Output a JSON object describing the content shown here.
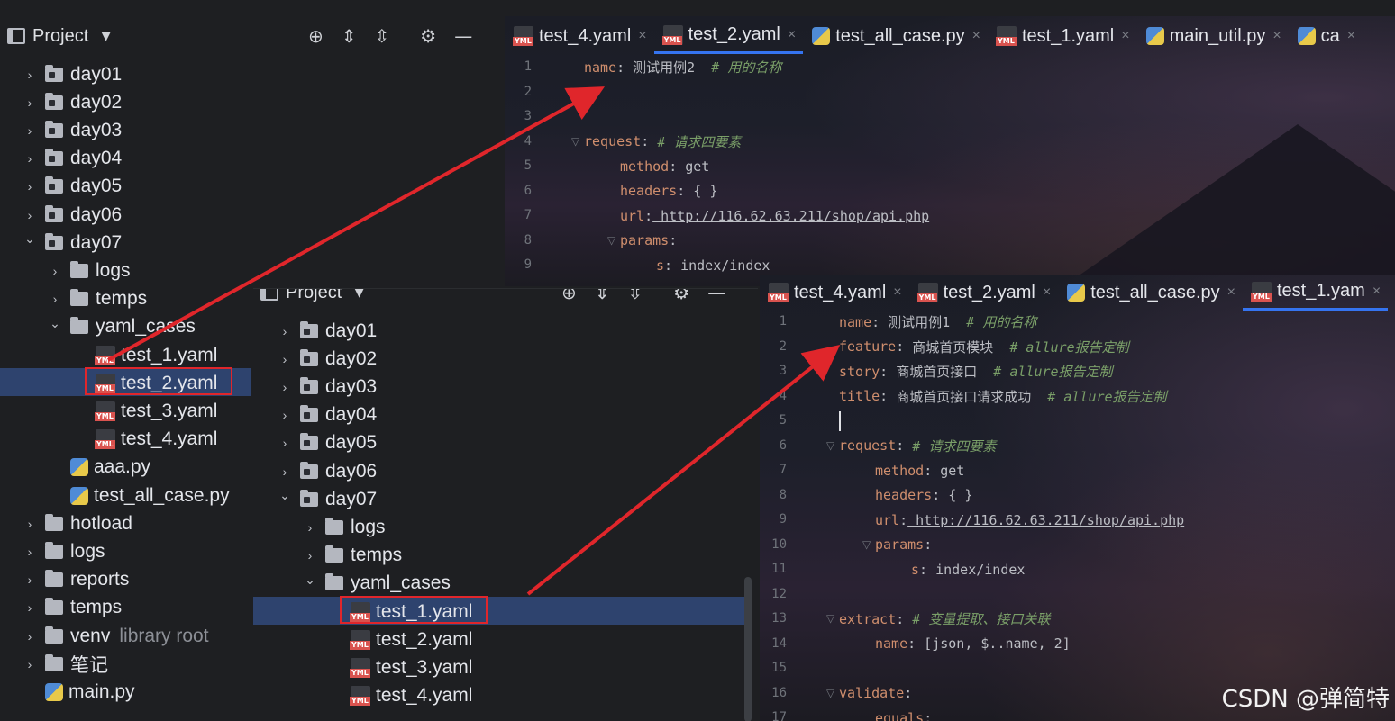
{
  "back_window": {
    "project_title": "Project",
    "tree": [
      {
        "label": "day01",
        "kind": "folder",
        "depth": 0,
        "open": false
      },
      {
        "label": "day02",
        "kind": "folder",
        "depth": 0,
        "open": false
      },
      {
        "label": "day03",
        "kind": "folder",
        "depth": 0,
        "open": false
      },
      {
        "label": "day04",
        "kind": "folder",
        "depth": 0,
        "open": false
      },
      {
        "label": "day05",
        "kind": "folder",
        "depth": 0,
        "open": false
      },
      {
        "label": "day06",
        "kind": "folder",
        "depth": 0,
        "open": false
      },
      {
        "label": "day07",
        "kind": "folder",
        "depth": 0,
        "open": true
      },
      {
        "label": "logs",
        "kind": "folder",
        "depth": 1,
        "open": false
      },
      {
        "label": "temps",
        "kind": "folder",
        "depth": 1,
        "open": false
      },
      {
        "label": "yaml_cases",
        "kind": "folder",
        "depth": 1,
        "open": true
      },
      {
        "label": "test_1.yaml",
        "kind": "yaml",
        "depth": 2
      },
      {
        "label": "test_2.yaml",
        "kind": "yaml",
        "depth": 2,
        "selected": true
      },
      {
        "label": "test_3.yaml",
        "kind": "yaml",
        "depth": 2
      },
      {
        "label": "test_4.yaml",
        "kind": "yaml",
        "depth": 2
      },
      {
        "label": "aaa.py",
        "kind": "py",
        "depth": 1
      },
      {
        "label": "test_all_case.py",
        "kind": "py",
        "depth": 1
      },
      {
        "label": "hotload",
        "kind": "folder",
        "depth": 0,
        "open": false
      },
      {
        "label": "logs",
        "kind": "folder",
        "depth": 0,
        "open": false
      },
      {
        "label": "reports",
        "kind": "folder",
        "depth": 0,
        "open": false
      },
      {
        "label": "temps",
        "kind": "folder",
        "depth": 0,
        "open": false
      },
      {
        "label": "venv",
        "kind": "folder",
        "depth": 0,
        "open": false,
        "suffix": "library root"
      },
      {
        "label": "笔记",
        "kind": "folder",
        "depth": 0,
        "open": false
      },
      {
        "label": "main.py",
        "kind": "py",
        "depth": 0
      }
    ],
    "tabs": [
      {
        "label": "test_4.yaml",
        "kind": "yaml"
      },
      {
        "label": "test_2.yaml",
        "kind": "yaml",
        "active": true
      },
      {
        "label": "test_all_case.py",
        "kind": "py"
      },
      {
        "label": "test_1.yaml",
        "kind": "yaml"
      },
      {
        "label": "main_util.py",
        "kind": "py"
      },
      {
        "label": "ca",
        "kind": "py"
      }
    ],
    "code": [
      {
        "n": "1",
        "indent": 0,
        "key": "name",
        "val": " 测试用例2",
        "comment": "  # 用的名称"
      },
      {
        "n": "2",
        "indent": 0
      },
      {
        "n": "3",
        "indent": 0
      },
      {
        "n": "4",
        "indent": 0,
        "key": "request",
        "val": "",
        "comment": " # 请求四要素"
      },
      {
        "n": "5",
        "indent": 1,
        "key": "method",
        "val": " get"
      },
      {
        "n": "6",
        "indent": 1,
        "key": "headers",
        "val": " { }"
      },
      {
        "n": "7",
        "indent": 1,
        "key": "url",
        "url": " http://116.62.63.211/shop/api.php"
      },
      {
        "n": "8",
        "indent": 1,
        "key": "params",
        "val": ""
      },
      {
        "n": "9",
        "indent": 2,
        "key": "s",
        "val": " index/index"
      }
    ]
  },
  "front_window": {
    "project_title": "Project",
    "tree": [
      {
        "label": "day01",
        "kind": "folder",
        "depth": 0,
        "open": false
      },
      {
        "label": "day02",
        "kind": "folder",
        "depth": 0,
        "open": false
      },
      {
        "label": "day03",
        "kind": "folder",
        "depth": 0,
        "open": false
      },
      {
        "label": "day04",
        "kind": "folder",
        "depth": 0,
        "open": false
      },
      {
        "label": "day05",
        "kind": "folder",
        "depth": 0,
        "open": false
      },
      {
        "label": "day06",
        "kind": "folder",
        "depth": 0,
        "open": false
      },
      {
        "label": "day07",
        "kind": "folder",
        "depth": 0,
        "open": true
      },
      {
        "label": "logs",
        "kind": "folder",
        "depth": 1,
        "open": false
      },
      {
        "label": "temps",
        "kind": "folder",
        "depth": 1,
        "open": false
      },
      {
        "label": "yaml_cases",
        "kind": "folder",
        "depth": 1,
        "open": true
      },
      {
        "label": "test_1.yaml",
        "kind": "yaml",
        "depth": 2,
        "selected": true
      },
      {
        "label": "test_2.yaml",
        "kind": "yaml",
        "depth": 2
      },
      {
        "label": "test_3.yaml",
        "kind": "yaml",
        "depth": 2
      },
      {
        "label": "test_4.yaml",
        "kind": "yaml",
        "depth": 2
      }
    ],
    "tabs": [
      {
        "label": "test_4.yaml",
        "kind": "yaml"
      },
      {
        "label": "test_2.yaml",
        "kind": "yaml"
      },
      {
        "label": "test_all_case.py",
        "kind": "py"
      },
      {
        "label": "test_1.yam",
        "kind": "yaml",
        "active": true
      }
    ],
    "code": [
      {
        "n": "1",
        "indent": 0,
        "key": "name",
        "val": " 测试用例1",
        "comment": "  # 用的名称"
      },
      {
        "n": "2",
        "indent": 0,
        "key": "feature",
        "val": " 商城首页模块",
        "comment": "  # allure报告定制"
      },
      {
        "n": "3",
        "indent": 0,
        "key": "story",
        "val": " 商城首页接口",
        "comment": "  # allure报告定制"
      },
      {
        "n": "4",
        "indent": 0,
        "key": "title",
        "val": " 商城首页接口请求成功",
        "comment": "  # allure报告定制"
      },
      {
        "n": "5",
        "indent": 0,
        "cursor": true
      },
      {
        "n": "6",
        "indent": 0,
        "key": "request",
        "val": "",
        "comment": " # 请求四要素"
      },
      {
        "n": "7",
        "indent": 1,
        "key": "method",
        "val": " get"
      },
      {
        "n": "8",
        "indent": 1,
        "key": "headers",
        "val": " { }"
      },
      {
        "n": "9",
        "indent": 1,
        "key": "url",
        "url": " http://116.62.63.211/shop/api.php"
      },
      {
        "n": "10",
        "indent": 1,
        "key": "params",
        "val": ""
      },
      {
        "n": "11",
        "indent": 2,
        "key": "s",
        "val": " index/index"
      },
      {
        "n": "12",
        "indent": 0
      },
      {
        "n": "13",
        "indent": 0,
        "key": "extract",
        "val": "",
        "comment": " # 变量提取、接口关联"
      },
      {
        "n": "14",
        "indent": 1,
        "key": "name",
        "val": " [json, $..name, 2]"
      },
      {
        "n": "15",
        "indent": 0
      },
      {
        "n": "16",
        "indent": 0,
        "key": "validate",
        "val": ""
      },
      {
        "n": "17",
        "indent": 1,
        "key": "equals",
        "val": ""
      }
    ]
  },
  "watermark": "CSDN @弹简特",
  "colors": {
    "annotation_red": "#e0262b",
    "selection": "#2e436e",
    "tab_underline": "#3574f0"
  }
}
